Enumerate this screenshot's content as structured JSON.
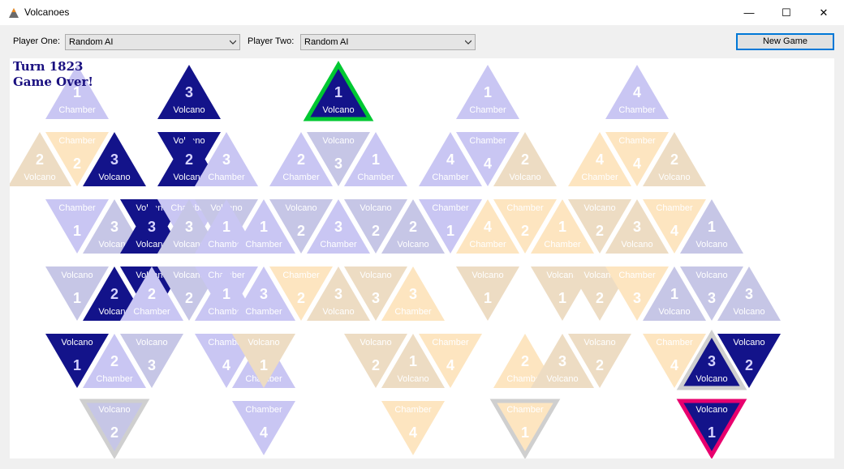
{
  "window": {
    "title": "Volcanoes",
    "minimize_glyph": "—",
    "maximize_glyph": "☐",
    "close_glyph": "✕"
  },
  "toolbar": {
    "player_one_label": "Player One:",
    "player_one_value": "Random AI",
    "player_two_label": "Player Two:",
    "player_two_value": "Random AI",
    "new_game_label": "New Game"
  },
  "status": {
    "turn": "Turn 1823",
    "message": "Game Over!"
  },
  "colors": {
    "blue_light": "#c9c6f3",
    "blue_faded": "#c6c6e6",
    "blue_dark": "#13138a",
    "orange_light": "#fde5c0",
    "orange_faded": "#eddcc3",
    "highlight_green": "#00c832",
    "highlight_pink": "#e8006e",
    "highlight_gray": "#cfcfcf"
  },
  "tiles": [
    {
      "c": 0,
      "r": 0,
      "d": 0,
      "v": "1",
      "l": "Chamber",
      "f": "bl"
    },
    {
      "c": 0,
      "r": 1,
      "d": 1,
      "v": "2",
      "l": "Chamber",
      "f": "ol"
    },
    {
      "c": 0,
      "r": 2,
      "d": 1,
      "v": "1",
      "l": "Chamber",
      "f": "bl"
    },
    {
      "c": 0,
      "r": 3,
      "d": 1,
      "v": "1",
      "l": "Volcano",
      "f": "bf"
    },
    {
      "c": 0,
      "r": 4,
      "d": 1,
      "v": "1",
      "l": "Volcano",
      "f": "bd"
    },
    {
      "c": -1,
      "r": 1,
      "d": 0,
      "v": "2",
      "l": "Volcano",
      "f": "of"
    },
    {
      "c": 1,
      "r": 1,
      "d": 0,
      "v": "3",
      "l": "Volcano",
      "f": "bd"
    },
    {
      "c": 1,
      "r": 2,
      "d": 0,
      "v": "3",
      "l": "Volcano",
      "f": "bf"
    },
    {
      "c": 1,
      "r": 3,
      "d": 0,
      "v": "2",
      "l": "Volcano",
      "f": "bd"
    },
    {
      "c": 1,
      "r": 4,
      "d": 0,
      "v": "2",
      "l": "Chamber",
      "f": "bl"
    },
    {
      "c": 1,
      "r": 5,
      "d": 1,
      "v": "2",
      "l": "Volcano",
      "f": "bf",
      "h": "gray"
    },
    {
      "c": 2,
      "r": 2,
      "d": 1,
      "v": "3",
      "l": "Volcano",
      "f": "bd"
    },
    {
      "c": 2,
      "r": 2,
      "d": 0,
      "v": "3",
      "l": "Volcano",
      "f": "bd"
    },
    {
      "c": 2,
      "r": 3,
      "d": 1,
      "v": "2",
      "l": "Volcano",
      "f": "bd"
    },
    {
      "c": 2,
      "r": 3,
      "d": 0,
      "v": "2",
      "l": "Chamber",
      "f": "bl"
    },
    {
      "c": 2,
      "r": 4,
      "d": 1,
      "v": "3",
      "l": "Volcano",
      "f": "bf"
    },
    {
      "c": 3,
      "r": 0,
      "d": 0,
      "v": "3",
      "l": "Volcano",
      "f": "bd"
    },
    {
      "c": 3,
      "r": 1,
      "d": 1,
      "v": "1",
      "l": "Volcano",
      "f": "bd"
    },
    {
      "c": 3,
      "r": 1,
      "d": 0,
      "v": "2",
      "l": "Volcano",
      "f": "bd"
    },
    {
      "c": 3,
      "r": 2,
      "d": 1,
      "v": "3",
      "l": "Chamber",
      "f": "bl"
    },
    {
      "c": 3,
      "r": 2,
      "d": 0,
      "v": "3",
      "l": "Volcano",
      "f": "bf"
    },
    {
      "c": 3,
      "r": 3,
      "d": 1,
      "v": "2",
      "l": "Volcano",
      "f": "bf"
    },
    {
      "c": 4,
      "r": 1,
      "d": 0,
      "v": "3",
      "l": "Chamber",
      "f": "bl"
    },
    {
      "c": 4,
      "r": 2,
      "d": 1,
      "v": "1",
      "l": "Volcano",
      "f": "bf"
    },
    {
      "c": 4,
      "r": 2,
      "d": 0,
      "v": "1",
      "l": "Chamber",
      "f": "bl"
    },
    {
      "c": 4,
      "r": 3,
      "d": 1,
      "v": "3",
      "l": "Chamber",
      "f": "bl"
    },
    {
      "c": 4,
      "r": 3,
      "d": 0,
      "v": "1",
      "l": "Chamber",
      "f": "bl"
    },
    {
      "c": 4,
      "r": 4,
      "d": 1,
      "v": "4",
      "l": "Chamber",
      "f": "bl"
    },
    {
      "c": 5,
      "r": 2,
      "d": 0,
      "v": "1",
      "l": "Chamber",
      "f": "bl"
    },
    {
      "c": 5,
      "r": 3,
      "d": 0,
      "v": "3",
      "l": "Chamber",
      "f": "bl"
    },
    {
      "c": 5,
      "r": 4,
      "d": 0,
      "v": "4",
      "l": "Chamber",
      "f": "bl"
    },
    {
      "c": 5,
      "r": 5,
      "d": 1,
      "v": "4",
      "l": "Chamber",
      "f": "bl"
    },
    {
      "c": 5,
      "r": 4,
      "d": 1,
      "v": "1",
      "l": "Volcano",
      "f": "of"
    },
    {
      "c": 6,
      "r": 1,
      "d": 0,
      "v": "2",
      "l": "Chamber",
      "f": "bl"
    },
    {
      "c": 6,
      "r": 2,
      "d": 1,
      "v": "2",
      "l": "Volcano",
      "f": "bf"
    },
    {
      "c": 6,
      "r": 3,
      "d": 1,
      "v": "2",
      "l": "Chamber",
      "f": "ol"
    },
    {
      "c": 7,
      "r": 0,
      "d": 0,
      "v": "1",
      "l": "Volcano",
      "f": "bd",
      "h": "green"
    },
    {
      "c": 7,
      "r": 1,
      "d": 1,
      "v": "3",
      "l": "Volcano",
      "f": "bf"
    },
    {
      "c": 7,
      "r": 2,
      "d": 0,
      "v": "3",
      "l": "Chamber",
      "f": "bl"
    },
    {
      "c": 7,
      "r": 3,
      "d": 0,
      "v": "3",
      "l": "Volcano",
      "f": "of"
    },
    {
      "c": 8,
      "r": 1,
      "d": 0,
      "v": "1",
      "l": "Chamber",
      "f": "bl"
    },
    {
      "c": 8,
      "r": 2,
      "d": 1,
      "v": "2",
      "l": "Volcano",
      "f": "bf"
    },
    {
      "c": 8,
      "r": 3,
      "d": 1,
      "v": "3",
      "l": "Volcano",
      "f": "of"
    },
    {
      "c": 8,
      "r": 4,
      "d": 1,
      "v": "2",
      "l": "Volcano",
      "f": "of"
    },
    {
      "c": 9,
      "r": 2,
      "d": 0,
      "v": "2",
      "l": "Volcano",
      "f": "bf"
    },
    {
      "c": 9,
      "r": 4,
      "d": 0,
      "v": "1",
      "l": "Volcano",
      "f": "of"
    },
    {
      "c": 9,
      "r": 5,
      "d": 1,
      "v": "4",
      "l": "Chamber",
      "f": "ol"
    },
    {
      "c": 9,
      "r": 3,
      "d": 0,
      "v": "3",
      "l": "Chamber",
      "f": "ol"
    },
    {
      "c": 10,
      "r": 1,
      "d": 0,
      "v": "4",
      "l": "Chamber",
      "f": "bl"
    },
    {
      "c": 10,
      "r": 2,
      "d": 1,
      "v": "1",
      "l": "Chamber",
      "f": "bl"
    },
    {
      "c": 10,
      "r": 4,
      "d": 1,
      "v": "4",
      "l": "Chamber",
      "f": "ol"
    },
    {
      "c": 11,
      "r": 0,
      "d": 0,
      "v": "1",
      "l": "Chamber",
      "f": "bl"
    },
    {
      "c": 11,
      "r": 1,
      "d": 1,
      "v": "4",
      "l": "Chamber",
      "f": "bl"
    },
    {
      "c": 11,
      "r": 2,
      "d": 0,
      "v": "4",
      "l": "Chamber",
      "f": "ol"
    },
    {
      "c": 11,
      "r": 3,
      "d": 1,
      "v": "1",
      "l": "Volcano",
      "f": "of"
    },
    {
      "c": 12,
      "r": 1,
      "d": 0,
      "v": "2",
      "l": "Volcano",
      "f": "of"
    },
    {
      "c": 12,
      "r": 2,
      "d": 1,
      "v": "2",
      "l": "Chamber",
      "f": "ol"
    },
    {
      "c": 12,
      "r": 4,
      "d": 0,
      "v": "2",
      "l": "Chamber",
      "f": "ol"
    },
    {
      "c": 12,
      "r": 5,
      "d": 1,
      "v": "1",
      "l": "Chamber",
      "f": "ol",
      "h": "gray"
    },
    {
      "c": 13,
      "r": 2,
      "d": 0,
      "v": "1",
      "l": "Chamber",
      "f": "ol"
    },
    {
      "c": 13,
      "r": 3,
      "d": 1,
      "v": "1",
      "l": "Volcano",
      "f": "of"
    },
    {
      "c": 13,
      "r": 4,
      "d": 0,
      "v": "3",
      "l": "Volcano",
      "f": "of"
    },
    {
      "c": 14,
      "r": 1,
      "d": 0,
      "v": "4",
      "l": "Chamber",
      "f": "ol"
    },
    {
      "c": 14,
      "r": 2,
      "d": 1,
      "v": "2",
      "l": "Volcano",
      "f": "of"
    },
    {
      "c": 14,
      "r": 3,
      "d": 1,
      "v": "2",
      "l": "Volcano",
      "f": "of"
    },
    {
      "c": 14,
      "r": 4,
      "d": 1,
      "v": "2",
      "l": "Volcano",
      "f": "of"
    },
    {
      "c": 15,
      "r": 0,
      "d": 0,
      "v": "4",
      "l": "Chamber",
      "f": "bl"
    },
    {
      "c": 15,
      "r": 1,
      "d": 1,
      "v": "4",
      "l": "Chamber",
      "f": "ol"
    },
    {
      "c": 15,
      "r": 2,
      "d": 0,
      "v": "3",
      "l": "Volcano",
      "f": "of"
    },
    {
      "c": 15,
      "r": 3,
      "d": 1,
      "v": "3",
      "l": "Chamber",
      "f": "ol"
    },
    {
      "c": 16,
      "r": 1,
      "d": 0,
      "v": "2",
      "l": "Volcano",
      "f": "of"
    },
    {
      "c": 16,
      "r": 2,
      "d": 1,
      "v": "4",
      "l": "Chamber",
      "f": "ol"
    },
    {
      "c": 16,
      "r": 4,
      "d": 1,
      "v": "4",
      "l": "Chamber",
      "f": "ol"
    },
    {
      "c": 16,
      "r": 3,
      "d": 0,
      "v": "1",
      "l": "Volcano",
      "f": "bf"
    },
    {
      "c": 17,
      "r": 2,
      "d": 0,
      "v": "1",
      "l": "Volcano",
      "f": "bf"
    },
    {
      "c": 17,
      "r": 3,
      "d": 1,
      "v": "3",
      "l": "Volcano",
      "f": "bf"
    },
    {
      "c": 17,
      "r": 4,
      "d": 0,
      "v": "3",
      "l": "Volcano",
      "f": "bd",
      "h": "gray"
    },
    {
      "c": 17,
      "r": 5,
      "d": 1,
      "v": "1",
      "l": "Volcano",
      "f": "bd",
      "h": "pink"
    },
    {
      "c": 18,
      "r": 3,
      "d": 0,
      "v": "3",
      "l": "Volcano",
      "f": "bf"
    },
    {
      "c": 18,
      "r": 4,
      "d": 1,
      "v": "2",
      "l": "Volcano",
      "f": "bd"
    }
  ]
}
